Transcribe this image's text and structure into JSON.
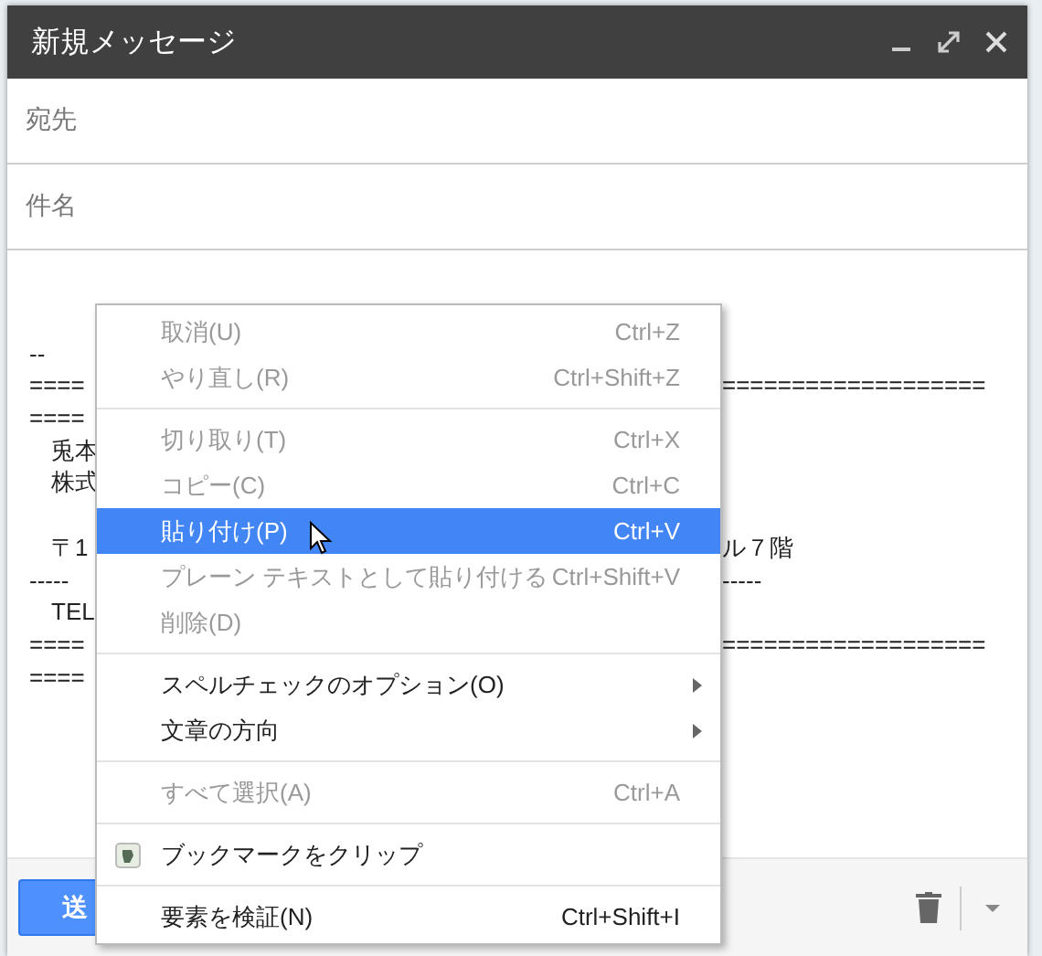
{
  "window": {
    "title": "新規メッセージ"
  },
  "fields": [
    {
      "label": "宛先"
    },
    {
      "label": "件名"
    }
  ],
  "body": [
    {
      "kind": "blank"
    },
    {
      "kind": "text",
      "left": "--",
      "indent": false
    },
    {
      "kind": "text",
      "left": "====",
      "right": "===================",
      "indent": false
    },
    {
      "kind": "text",
      "left": "====",
      "indent": false
    },
    {
      "kind": "text",
      "left": "兎本",
      "indent": true
    },
    {
      "kind": "text",
      "left": "株式",
      "indent": true
    },
    {
      "kind": "blank"
    },
    {
      "kind": "text",
      "left": "〒1",
      "right": "ル７階",
      "indent": true
    },
    {
      "kind": "text",
      "left": "-----",
      "right": "-----",
      "indent": false
    },
    {
      "kind": "text",
      "left": "TEL",
      "indent": true
    },
    {
      "kind": "text",
      "left": "====",
      "right": "===================",
      "indent": false
    },
    {
      "kind": "text",
      "left": "====",
      "indent": false
    }
  ],
  "send_button": {
    "label": "送"
  },
  "context_menu": [
    {
      "kind": "item",
      "label": "取消(U)",
      "shortcut": "Ctrl+Z",
      "disabled": true,
      "selected": false
    },
    {
      "kind": "item",
      "label": "やり直し(R)",
      "shortcut": "Ctrl+Shift+Z",
      "disabled": true,
      "selected": false
    },
    {
      "kind": "separator"
    },
    {
      "kind": "item",
      "label": "切り取り(T)",
      "shortcut": "Ctrl+X",
      "disabled": true,
      "selected": false
    },
    {
      "kind": "item",
      "label": "コピー(C)",
      "shortcut": "Ctrl+C",
      "disabled": true,
      "selected": false
    },
    {
      "kind": "item",
      "label": "貼り付け(P)",
      "shortcut": "Ctrl+V",
      "disabled": false,
      "selected": true
    },
    {
      "kind": "item",
      "label": "プレーン テキストとして貼り付ける",
      "shortcut": "Ctrl+Shift+V",
      "disabled": true,
      "selected": false
    },
    {
      "kind": "item",
      "label": "削除(D)",
      "disabled": true,
      "selected": false
    },
    {
      "kind": "separator"
    },
    {
      "kind": "submenu",
      "label": "スペルチェックのオプション(O)",
      "disabled": false,
      "selected": false
    },
    {
      "kind": "submenu",
      "label": "文章の方向",
      "disabled": false,
      "selected": false
    },
    {
      "kind": "separator"
    },
    {
      "kind": "item",
      "label": "すべて選択(A)",
      "shortcut": "Ctrl+A",
      "disabled": true,
      "selected": false
    },
    {
      "kind": "separator"
    },
    {
      "kind": "extension",
      "label": "ブックマークをクリップ",
      "disabled": false,
      "selected": false
    },
    {
      "kind": "separator"
    },
    {
      "kind": "item",
      "label": "要素を検証(N)",
      "shortcut": "Ctrl+Shift+I",
      "disabled": false,
      "selected": false
    }
  ]
}
